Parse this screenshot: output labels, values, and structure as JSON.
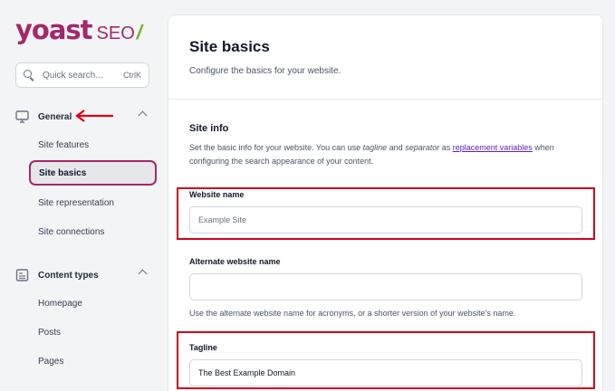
{
  "logo": {
    "brand": "yoast",
    "product": "SEO",
    "slash": "/"
  },
  "search": {
    "placeholder": "Quick search...",
    "shortcut": "CtrlK"
  },
  "sidebar": {
    "sections": [
      {
        "label": "General",
        "icon": "monitor-icon",
        "items": [
          {
            "label": "Site features"
          },
          {
            "label": "Site basics"
          },
          {
            "label": "Site representation"
          },
          {
            "label": "Site connections"
          }
        ]
      },
      {
        "label": "Content types",
        "icon": "document-icon",
        "items": [
          {
            "label": "Homepage"
          },
          {
            "label": "Posts"
          },
          {
            "label": "Pages"
          }
        ]
      }
    ]
  },
  "page": {
    "title": "Site basics",
    "subtitle": "Configure the basics for your website."
  },
  "site_info": {
    "title": "Site info",
    "desc_part1": "Set the basic info for your website. You can use ",
    "desc_tagline": "tagline",
    "desc_part2": " and ",
    "desc_separator": "separator",
    "desc_part3": " as ",
    "desc_link": "replacement variables",
    "desc_part4": " when configuring the search appearance of your content."
  },
  "fields": {
    "website_name": {
      "label": "Website name",
      "value": "",
      "placeholder": "Example Site"
    },
    "alternate_name": {
      "label": "Alternate website name",
      "value": "",
      "help": "Use the alternate website name for acronyms, or a shorter version of your website's name."
    },
    "tagline": {
      "label": "Tagline",
      "value": "The Best Example Domain"
    }
  },
  "colors": {
    "brand": "#a4286a",
    "accent_green": "#77b227",
    "highlight": "#d0021b",
    "link": "#5b21b6"
  }
}
